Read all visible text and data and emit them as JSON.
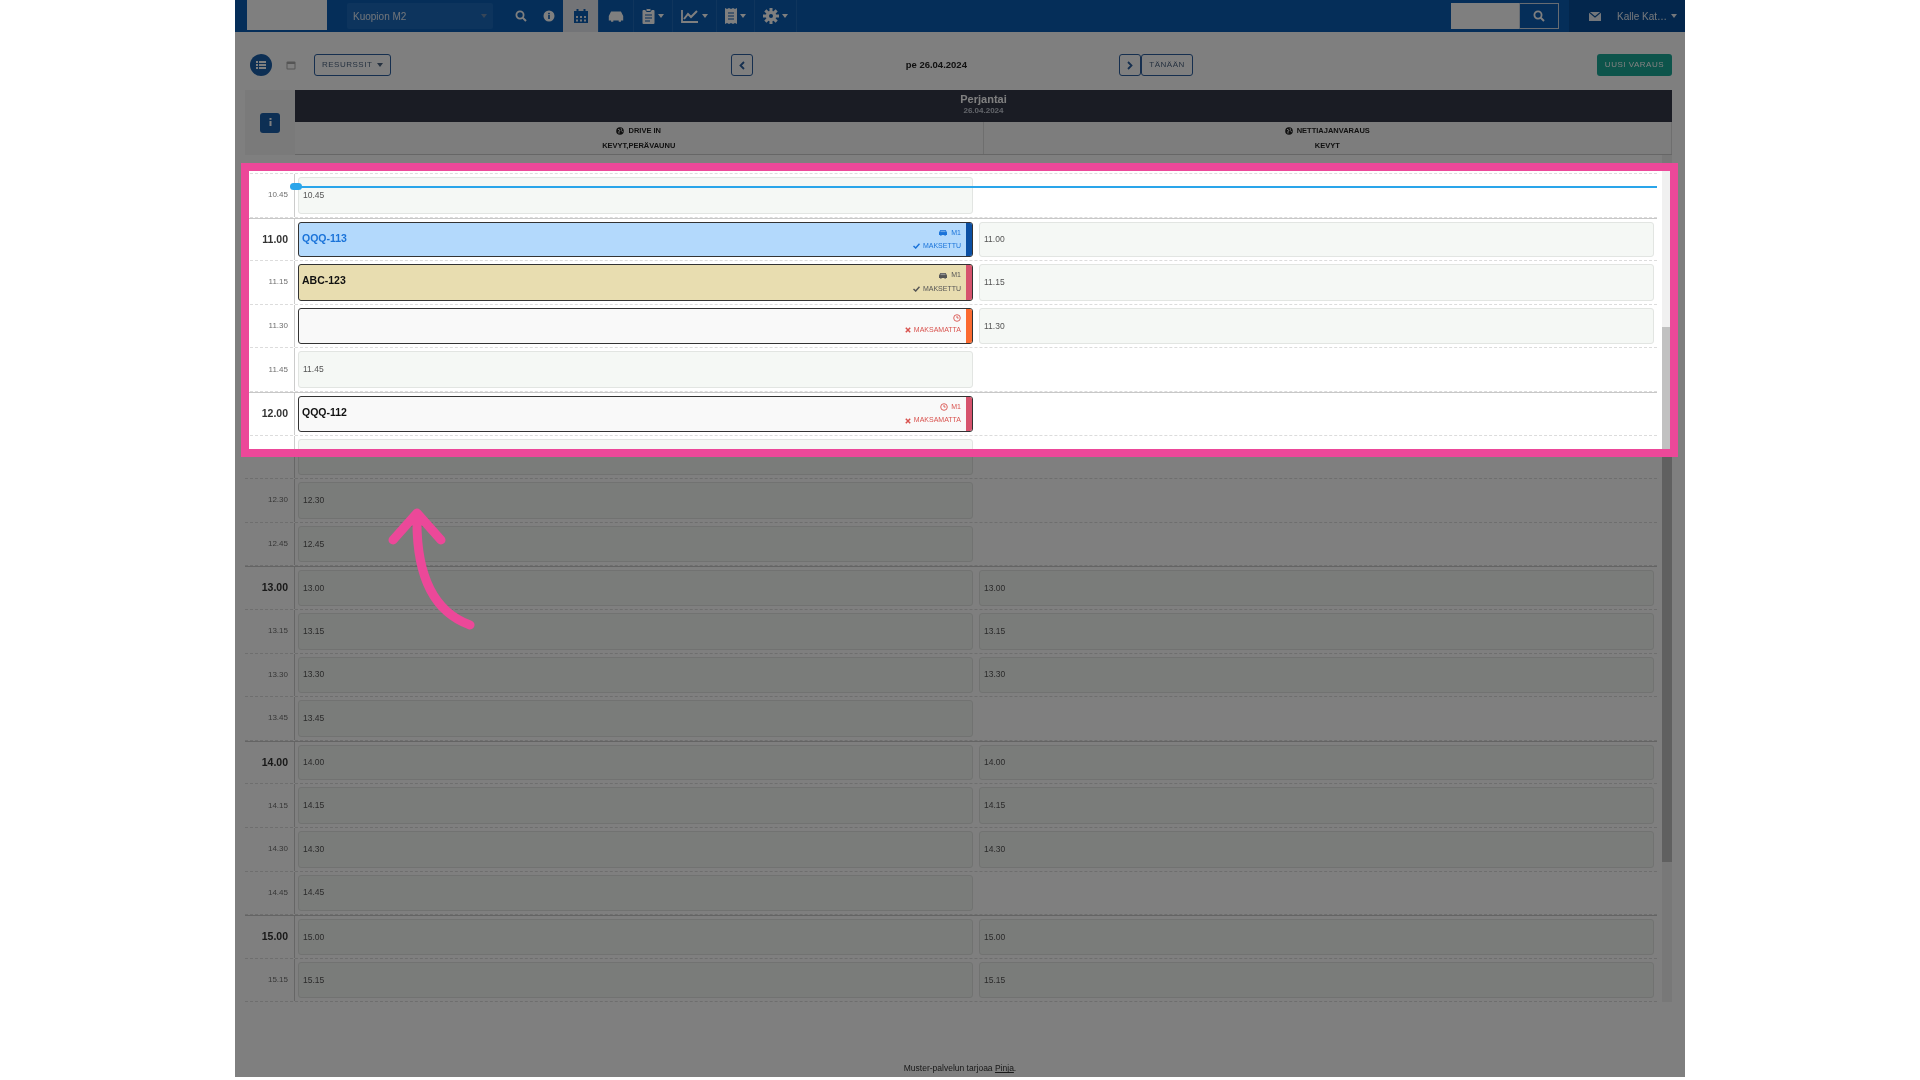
{
  "topbar": {
    "location": "Kuopion M2",
    "user": "Kalle Kat…"
  },
  "toolbar": {
    "views": [
      {
        "kind": "list",
        "selected": true
      },
      {
        "kind": "calendar",
        "selected": false
      }
    ],
    "resources_button": "RESURSSIT",
    "date": "pe 26.04.2024",
    "today_button": "TÄNÄÄN",
    "new_button": "UUSI VARAUS"
  },
  "day": {
    "name": "Perjantai",
    "date": "26.04.2024"
  },
  "resources": [
    {
      "name": "DRIVE IN",
      "types": "KEVYT,PERÄVAUNU"
    },
    {
      "name": "NETTIAJANVARAUS",
      "types": "KEVYT"
    }
  ],
  "rows": [
    {
      "time": "10.45",
      "hour": false,
      "now": true,
      "cells": [
        {
          "kind": "slot",
          "label": "10.45"
        },
        {
          "kind": "empty"
        }
      ]
    },
    {
      "time": "11.00",
      "hour": true,
      "now": false,
      "cells": [
        {
          "kind": "booking",
          "plate": "QQQ-113",
          "color": "#b3d9fc",
          "selected": true,
          "resource": "M1",
          "payment": "MAKSETTU",
          "paid": true
        },
        {
          "kind": "slot",
          "label": "11.00"
        }
      ]
    },
    {
      "time": "11.15",
      "hour": false,
      "now": false,
      "cells": [
        {
          "kind": "booking",
          "plate": "ABC-123",
          "color": "#e8ddb0",
          "selected": false,
          "resource": "M1",
          "payment": "MAKSETTU",
          "paid": true
        },
        {
          "kind": "slot",
          "label": "11.15"
        }
      ]
    },
    {
      "time": "11.30",
      "hour": false,
      "now": false,
      "cells": [
        {
          "kind": "booking",
          "color": "#f9f9f9",
          "selected": false,
          "payment": "MAKSAMATTA",
          "paid": false
        },
        {
          "kind": "slot",
          "label": "11.30"
        }
      ]
    },
    {
      "time": "11.45",
      "hour": false,
      "now": false,
      "cells": [
        {
          "kind": "slot",
          "label": "11.45"
        },
        {
          "kind": "empty"
        }
      ]
    },
    {
      "time": "12.00",
      "hour": true,
      "now": false,
      "cells": [
        {
          "kind": "booking",
          "plate": "QQQ-112",
          "color": "#f9f9f9",
          "selected": false,
          "resource": "M1",
          "payment": "MAKSAMATTA",
          "paid": false
        },
        {
          "kind": "empty"
        }
      ]
    },
    {
      "hour": false,
      "now": false,
      "cells": [
        {
          "kind": "slot"
        },
        {
          "kind": "empty"
        }
      ]
    },
    {
      "time": "12.30",
      "hour": false,
      "now": false,
      "cells": [
        {
          "kind": "slot",
          "label": "12.30"
        },
        {
          "kind": "empty"
        }
      ]
    },
    {
      "time": "12.45",
      "hour": false,
      "now": false,
      "cells": [
        {
          "kind": "slot",
          "label": "12.45"
        },
        {
          "kind": "empty"
        }
      ]
    },
    {
      "time": "13.00",
      "hour": true,
      "now": false,
      "cells": [
        {
          "kind": "slot",
          "label": "13.00"
        },
        {
          "kind": "slot",
          "label": "13.00"
        }
      ]
    },
    {
      "time": "13.15",
      "hour": false,
      "now": false,
      "cells": [
        {
          "kind": "slot",
          "label": "13.15"
        },
        {
          "kind": "slot",
          "label": "13.15"
        }
      ]
    },
    {
      "time": "13.30",
      "hour": false,
      "now": false,
      "cells": [
        {
          "kind": "slot",
          "label": "13.30"
        },
        {
          "kind": "slot",
          "label": "13.30"
        }
      ]
    },
    {
      "time": "13.45",
      "hour": false,
      "now": false,
      "cells": [
        {
          "kind": "slot",
          "label": "13.45"
        },
        {
          "kind": "empty"
        }
      ]
    },
    {
      "time": "14.00",
      "hour": true,
      "now": false,
      "cells": [
        {
          "kind": "slot",
          "label": "14.00"
        },
        {
          "kind": "slot",
          "label": "14.00"
        }
      ]
    },
    {
      "time": "14.15",
      "hour": false,
      "now": false,
      "cells": [
        {
          "kind": "slot",
          "label": "14.15"
        },
        {
          "kind": "slot",
          "label": "14.15"
        }
      ]
    },
    {
      "time": "14.30",
      "hour": false,
      "now": false,
      "cells": [
        {
          "kind": "slot",
          "label": "14.30"
        },
        {
          "kind": "slot",
          "label": "14.30"
        }
      ]
    },
    {
      "time": "14.45",
      "hour": false,
      "now": false,
      "cells": [
        {
          "kind": "slot",
          "label": "14.45"
        },
        {
          "kind": "empty"
        }
      ]
    },
    {
      "time": "15.00",
      "hour": true,
      "now": false,
      "cells": [
        {
          "kind": "slot",
          "label": "15.00"
        },
        {
          "kind": "slot",
          "label": "15.00"
        }
      ]
    },
    {
      "time": "15.15",
      "hour": false,
      "now": false,
      "cells": [
        {
          "kind": "slot",
          "label": "15.15"
        },
        {
          "kind": "slot",
          "label": "15.15"
        }
      ]
    }
  ],
  "footer": {
    "text": "Muster-palvelun tarjoaa",
    "link": "Pinja",
    "suffix": "."
  }
}
